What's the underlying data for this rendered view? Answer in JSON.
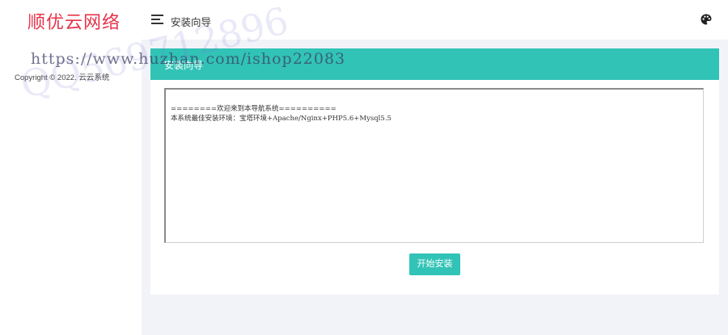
{
  "brand": {
    "name": "顺优云网络"
  },
  "sidebar": {
    "copyright": "Copyright © 2022. 云云系统"
  },
  "topbar": {
    "title": "安装向导",
    "menu_icon": "menu-icon",
    "theme_icon": "palette-icon"
  },
  "card": {
    "header_title": "安装向导",
    "terminal_lines": [
      "========欢迎来到本导航系统==========",
      "本系统最佳安装环境：宝塔环境+Apache/Nginx+PHP5.6+Mysql5.5"
    ],
    "start_button": "开始安装"
  },
  "watermark": {
    "url": "https://www.huzhan.com/ishop22083",
    "qq": "QQ569712896"
  },
  "colors": {
    "accent": "#31c3b6",
    "brand": "#e8334a",
    "background": "#f2f3f8"
  }
}
